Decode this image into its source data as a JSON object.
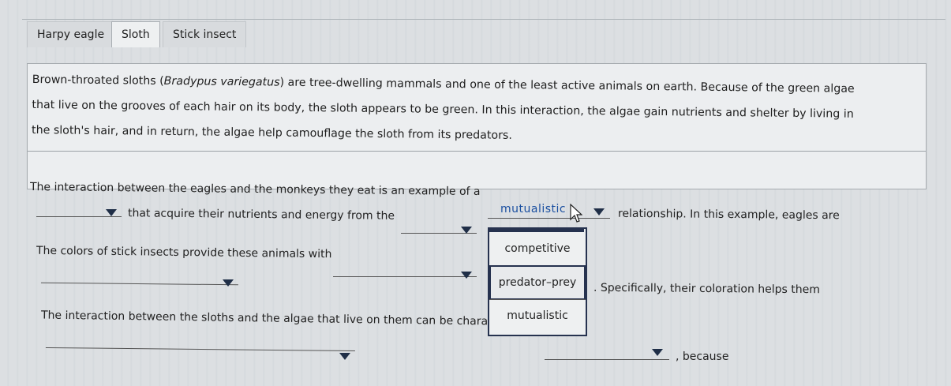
{
  "tabs": [
    {
      "label": "Harpy eagle",
      "active": false
    },
    {
      "label": "Sloth",
      "active": true
    },
    {
      "label": "Stick insect",
      "active": false
    }
  ],
  "passage": {
    "line1_a": "Brown-throated sloths (",
    "line1_species": "Bradypus variegatus",
    "line1_b": ") are tree-dwelling mammals and one of the least active animals on earth. Because of the green algae",
    "line2": "that live on the grooves of each hair on its body, the sloth appears to be green. In this interaction, the algae gain nutrients and shelter by living in",
    "line3": "the sloth's hair, and in return, the algae help camouflage the sloth from its predators."
  },
  "questions": {
    "q1_part1": "The interaction between the eagles and the monkeys they eat is an example of a",
    "q1_selected": "mutualistic",
    "q1_part2": "relationship. In this example, eagles are",
    "q1_part3": "that acquire their nutrients and energy from the",
    "q2_part1": "The colors of stick insects provide these animals with",
    "q2_part2": ". Specifically, their coloration helps them",
    "q3_part1": "The interaction between the sloths and the algae that live on them can be characterized as",
    "q3_part2": ", because"
  },
  "dropdown": {
    "options": [
      "competitive",
      "predator–prey",
      "mutualistic"
    ],
    "highlighted_index": 1
  },
  "colors": {
    "accent": "#1f2e47",
    "selected_text": "#1a4fa0"
  }
}
